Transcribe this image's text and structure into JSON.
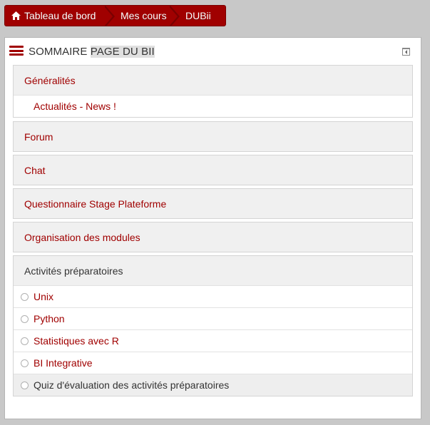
{
  "breadcrumb": {
    "home_label": "Tableau de bord",
    "courses_label": "Mes cours",
    "current_label": "DUBii"
  },
  "block": {
    "title_prefix": "SOMMAIRE ",
    "title_highlight": "PAGE DU BII"
  },
  "sections": {
    "generalites": {
      "label": "Généralités",
      "items": [
        "Actualités - News !"
      ]
    },
    "forum": {
      "label": "Forum"
    },
    "chat": {
      "label": "Chat"
    },
    "questionnaire": {
      "label": "Questionnaire Stage Plateforme"
    },
    "organisation": {
      "label": "Organisation des modules"
    },
    "activites": {
      "label": "Activités préparatoires",
      "items": [
        "Unix",
        "Python",
        "Statistiques avec R",
        "BI Integrative",
        "Quiz d'évaluation des activités préparatoires"
      ]
    }
  },
  "colors": {
    "accent": "#a00000",
    "page_background": "#c8c8c8",
    "section_header_background": "#f0f0f0"
  },
  "icons": {
    "home": "home-icon",
    "menu": "hamburger-menu-icon",
    "dock": "dock-block-icon",
    "activity_status": "empty-radio-icon"
  }
}
